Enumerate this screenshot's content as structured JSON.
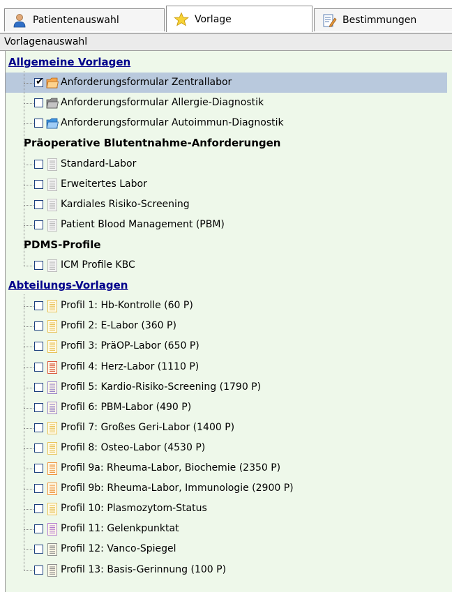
{
  "tabs": [
    {
      "label": "Patientenauswahl",
      "icon": "person-icon",
      "active": false
    },
    {
      "label": "Vorlage",
      "icon": "star-icon",
      "active": true
    },
    {
      "label": "Bestimmungen",
      "icon": "notepad-edit-icon",
      "active": false
    }
  ],
  "header": {
    "title": "Vorlagenauswahl"
  },
  "tree": {
    "group_allgemein": "Allgemeine Vorlagen",
    "allgemein_items": [
      {
        "label": "Anforderungsformular Zentrallabor",
        "checked": true,
        "icon": "folder-orange-icon",
        "selected": true
      },
      {
        "label": "Anforderungsformular Allergie-Diagnostik",
        "checked": false,
        "icon": "folder-gray-icon"
      },
      {
        "label": "Anforderungsformular Autoimmun-Diagnostik",
        "checked": false,
        "icon": "folder-blue-icon"
      }
    ],
    "sub_praeop": "Präoperative Blutentnahme-Anforderungen",
    "praeop_items": [
      {
        "label": "Standard-Labor",
        "checked": false,
        "icon": "document-icon"
      },
      {
        "label": "Erweitertes Labor",
        "checked": false,
        "icon": "document-icon"
      },
      {
        "label": "Kardiales Risiko-Screening",
        "checked": false,
        "icon": "document-icon"
      },
      {
        "label": "Patient Blood Management (PBM)",
        "checked": false,
        "icon": "document-icon"
      }
    ],
    "sub_pdms": "PDMS-Profile",
    "pdms_items": [
      {
        "label": "ICM Profile KBC",
        "checked": false,
        "icon": "document-icon"
      }
    ],
    "group_abteilung": "Abteilungs-Vorlagen",
    "abteilung_items": [
      {
        "label": "Profil 1: Hb-Kontrolle (60 P)",
        "checked": false,
        "icon": "document-yellow-icon",
        "color": "#e8c35a"
      },
      {
        "label": "Profil 2: E-Labor (360 P)",
        "checked": false,
        "icon": "document-yellow-icon",
        "color": "#e8c35a"
      },
      {
        "label": "Profil 3: PräOP-Labor (650 P)",
        "checked": false,
        "icon": "document-yellow-icon",
        "color": "#e8c35a"
      },
      {
        "label": "Profil 4: Herz-Labor (1110 P)",
        "checked": false,
        "icon": "document-red-icon",
        "color": "#d9573b"
      },
      {
        "label": "Profil 5: Kardio-Risiko-Screening (1790 P)",
        "checked": false,
        "icon": "document-purple-icon",
        "color": "#9a86c9"
      },
      {
        "label": "Profil 6: PBM-Labor (490 P)",
        "checked": false,
        "icon": "document-purple-icon",
        "color": "#9a86c9"
      },
      {
        "label": "Profil 7: Großes Geri-Labor (1400 P)",
        "checked": false,
        "icon": "document-yellow-icon",
        "color": "#e8c35a"
      },
      {
        "label": "Profil 8: Osteo-Labor (4530 P)",
        "checked": false,
        "icon": "document-yellow-icon",
        "color": "#e8c35a"
      },
      {
        "label": "Profil 9a: Rheuma-Labor, Biochemie (2350 P)",
        "checked": false,
        "icon": "document-orange-icon",
        "color": "#ee9640"
      },
      {
        "label": "Profil 9b: Rheuma-Labor, Immunologie (2900 P)",
        "checked": false,
        "icon": "document-orange-icon",
        "color": "#ee9640"
      },
      {
        "label": "Profil 10: Plasmozytom-Status",
        "checked": false,
        "icon": "document-yellow-icon",
        "color": "#e8c35a"
      },
      {
        "label": "Profil 11: Gelenkpunktat",
        "checked": false,
        "icon": "document-violet-icon",
        "color": "#b27ad0"
      },
      {
        "label": "Profil 12: Vanco-Spiegel",
        "checked": false,
        "icon": "document-gray-icon",
        "color": "#8d8d8d"
      },
      {
        "label": "Profil 13: Basis-Gerinnung (100 P)",
        "checked": false,
        "icon": "document-gray-icon",
        "color": "#8d8d8d"
      }
    ]
  },
  "colors": {
    "tree_background": "#eef8ea",
    "selection": "#b9c9dd",
    "group_link": "#00008b"
  }
}
